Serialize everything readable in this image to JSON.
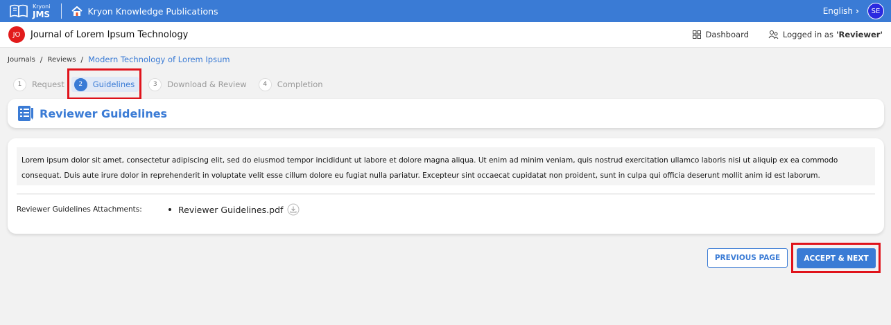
{
  "topbar": {
    "logo_small": "Kryoni",
    "logo_big": "JMS",
    "publisher": "Kryon Knowledge Publications",
    "language": "English",
    "user_initials": "SE"
  },
  "journal": {
    "badge": "JO",
    "title": "Journal of Lorem Ipsum Technology",
    "dashboard": "Dashboard",
    "logged_prefix": "Logged in as",
    "role": "'Reviewer'"
  },
  "breadcrumb": {
    "items": [
      "Journals",
      "Reviews",
      "Modern Technology of Lorem Ipsum"
    ]
  },
  "stepper": {
    "steps": [
      {
        "num": "1",
        "label": "Request"
      },
      {
        "num": "2",
        "label": "Guidelines"
      },
      {
        "num": "3",
        "label": "Download & Review"
      },
      {
        "num": "4",
        "label": "Completion"
      }
    ],
    "active_index": 1
  },
  "guidelines": {
    "title": "Reviewer Guidelines",
    "body": "Lorem ipsum dolor sit amet, consectetur adipiscing elit, sed do eiusmod tempor incididunt ut labore et dolore magna aliqua. Ut enim ad minim veniam, quis nostrud exercitation ullamco laboris nisi ut aliquip ex ea commodo consequat. Duis aute irure dolor in reprehenderit in voluptate velit esse cillum dolore eu fugiat nulla pariatur. Excepteur sint occaecat cupidatat non proident, sunt in culpa qui officia deserunt mollit anim id est laborum.",
    "attachments_label": "Reviewer Guidelines Attachments:",
    "attachment_name": "Reviewer Guidelines.pdf"
  },
  "actions": {
    "previous": "PREVIOUS PAGE",
    "accept": "ACCEPT & NEXT"
  },
  "colors": {
    "primary": "#3a7bd5",
    "highlight": "#e0131b",
    "journal_badge": "#e21b1b"
  }
}
